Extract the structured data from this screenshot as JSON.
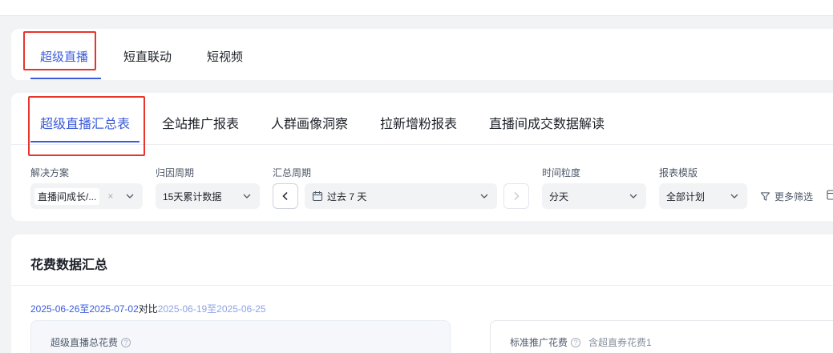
{
  "top_tabs": [
    "超级直播",
    "短直联动",
    "短视频"
  ],
  "sub_tabs": [
    "超级直播汇总表",
    "全站推广报表",
    "人群画像洞察",
    "拉新增粉报表",
    "直播间成交数据解读"
  ],
  "filters": {
    "solution": {
      "label": "解决方案",
      "value": "直播间成长/...",
      "clear": "×"
    },
    "attribution": {
      "label": "归因周期",
      "value": "15天累计数据"
    },
    "summary_period": {
      "label": "汇总周期",
      "value": "过去 7 天"
    },
    "granularity": {
      "label": "时间粒度",
      "value": "分天"
    },
    "template": {
      "label": "报表模版",
      "value": "全部计划"
    },
    "more_filters": "更多筛选"
  },
  "summary": {
    "title": "花费数据汇总",
    "date_range": "2025-06-26至2025-07-02",
    "compare_label": "对比",
    "compare_range": "2025-06-19至2025-06-25",
    "metric1_label": "超级直播总花费",
    "metric2_label": "标准推广花费",
    "metric2_note": "含超直券花费1",
    "help_glyph": "?"
  },
  "colors": {
    "accent": "#3b5bdb",
    "highlight_box": "#e8352b"
  }
}
